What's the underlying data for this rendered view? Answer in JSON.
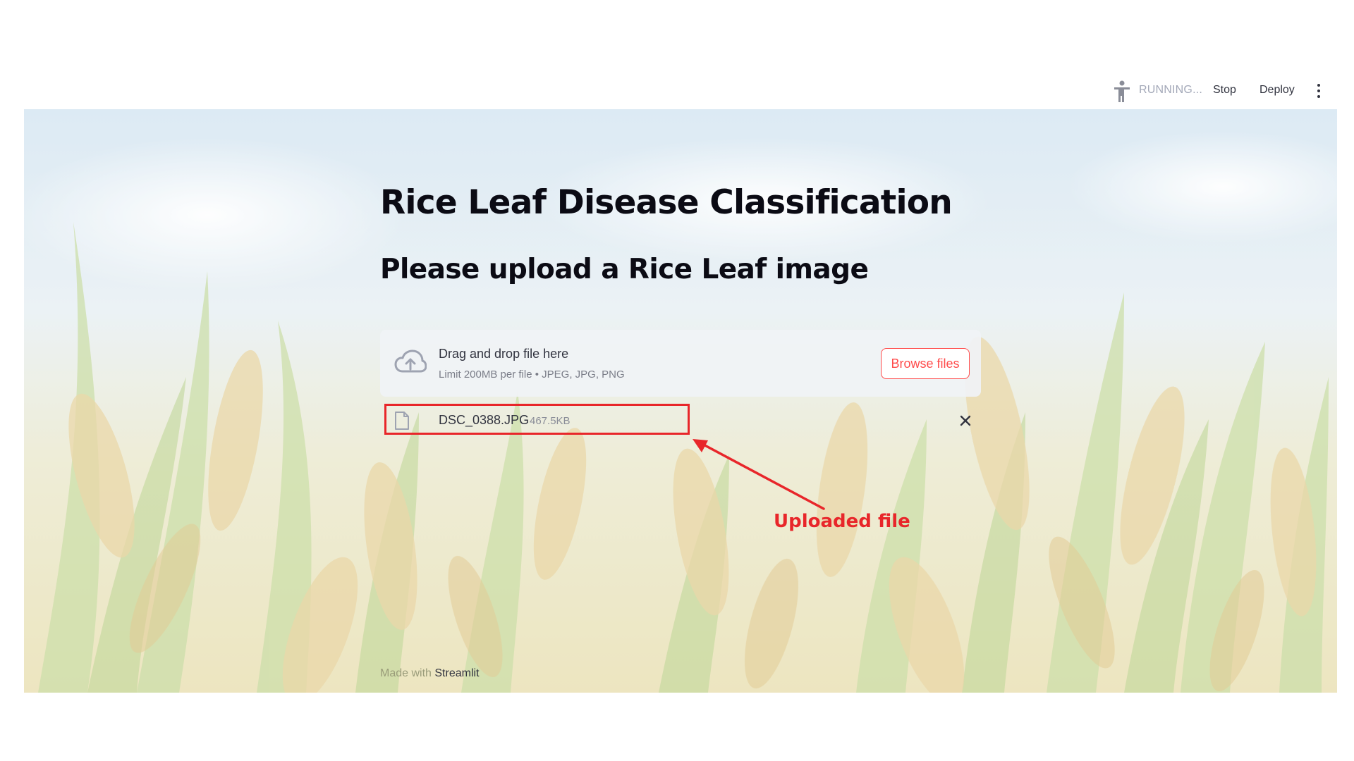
{
  "toolbar": {
    "status": "RUNNING...",
    "stop_label": "Stop",
    "deploy_label": "Deploy",
    "icons": {
      "running": "running-man-icon",
      "menu": "kebab-menu-icon"
    }
  },
  "main": {
    "title": "Rice Leaf Disease Classification",
    "subtitle": "Please upload a Rice Leaf image",
    "uploader": {
      "drop_label": "Drag and drop file here",
      "limit_text": "Limit 200MB per file • JPEG, JPG, PNG",
      "browse_label": "Browse files",
      "upload_icon": "cloud-upload-icon"
    },
    "uploaded_file": {
      "name": "DSC_0388.JPG",
      "size": "467.5KB",
      "file_icon": "file-icon",
      "remove_icon": "close-icon"
    }
  },
  "annotation": {
    "label": "Uploaded file",
    "color": "#e8262a"
  },
  "footer": {
    "prefix": "Made with",
    "link": "Streamlit"
  },
  "colors": {
    "accent": "#ff4b4b",
    "text": "#31333f",
    "sky": "#cfe3f1",
    "field": "#d9d49a"
  }
}
